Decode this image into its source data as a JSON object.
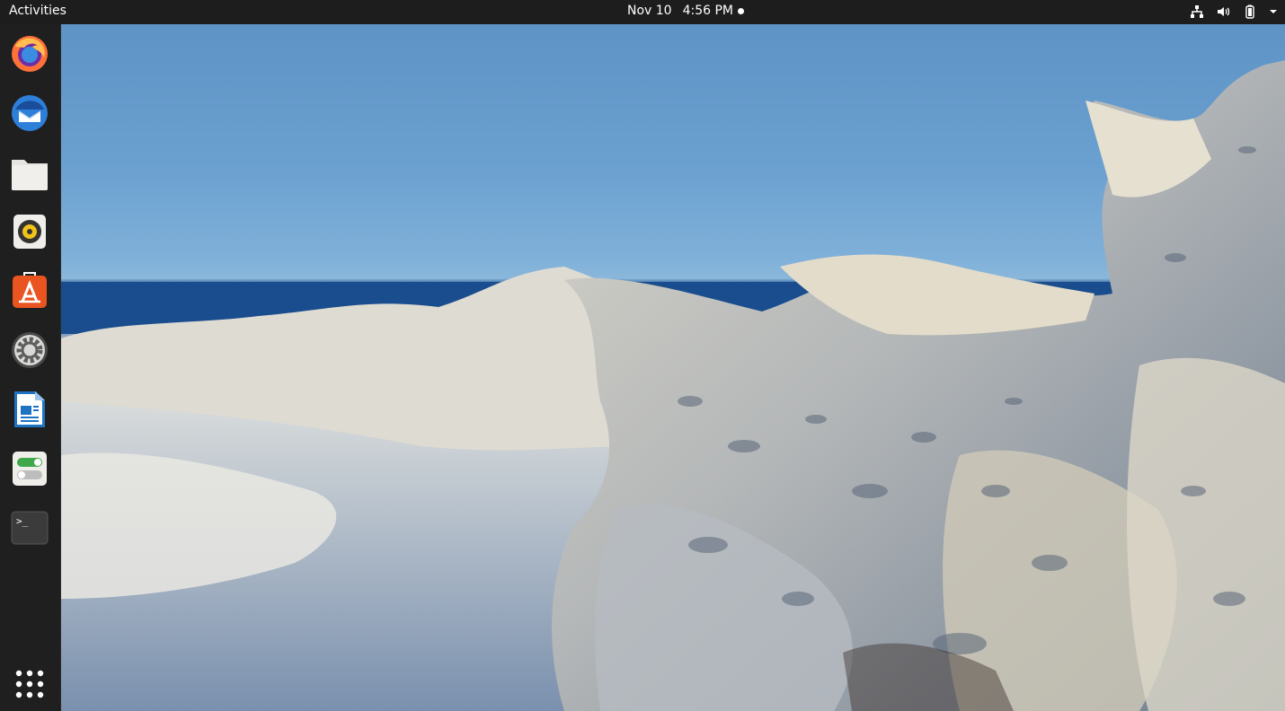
{
  "topbar": {
    "activities_label": "Activities",
    "date": "Nov 10",
    "time": "4:56 PM"
  },
  "tray": {
    "icons": [
      "network-icon",
      "volume-icon",
      "battery-icon",
      "system-menu-arrow-icon"
    ]
  },
  "dock": {
    "apps": [
      {
        "name": "Firefox Web Browser",
        "icon": "firefox-icon"
      },
      {
        "name": "Thunderbird Mail",
        "icon": "thunderbird-icon"
      },
      {
        "name": "Files",
        "icon": "files-icon"
      },
      {
        "name": "Rhythmbox",
        "icon": "rhythmbox-icon"
      },
      {
        "name": "Ubuntu Software",
        "icon": "ubuntu-software-icon"
      },
      {
        "name": "Settings",
        "icon": "settings-icon"
      },
      {
        "name": "LibreOffice Writer",
        "icon": "libreoffice-writer-icon"
      },
      {
        "name": "Tweaks",
        "icon": "tweaks-icon"
      },
      {
        "name": "Terminal",
        "icon": "terminal-icon"
      }
    ],
    "show_apps_icon": "show-applications-icon",
    "terminal_glyph": ">_"
  },
  "colors": {
    "topbar_bg": "#1d1d1d",
    "dock_bg": "#1f1f1f",
    "ubuntu_orange": "#e95420"
  }
}
